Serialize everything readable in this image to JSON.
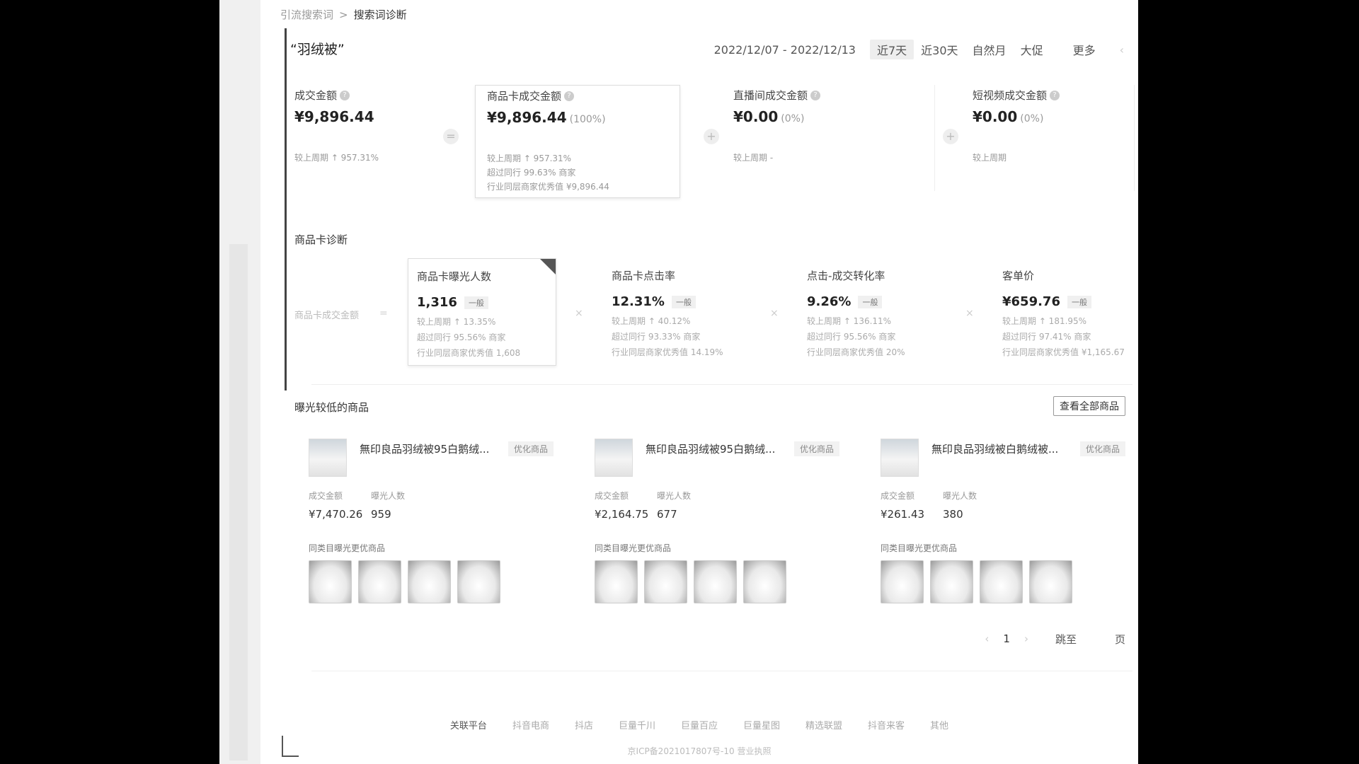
{
  "breadcrumb": {
    "parent": "引流搜索词",
    "sep": ">",
    "current": "搜索词诊断"
  },
  "keyword": "“羽绒被”",
  "date": {
    "range": "2022/12/07 - 2022/12/13",
    "options": [
      "近7天",
      "近30天",
      "自然月",
      "大促",
      "更多"
    ],
    "active": "近7天",
    "chevron": "‹"
  },
  "metrics": [
    {
      "label": "成交金额",
      "value": "¥9,896.44",
      "pct": "",
      "sub1": "较上周期 ↑ 957.31%",
      "sub2": "",
      "sub3": ""
    },
    {
      "label": "商品卡成交金额",
      "value": "¥9,896.44",
      "pct": "(100%)",
      "sub1": "较上周期 ↑ 957.31%",
      "sub2": "超过同行 99.63% 商家",
      "sub3": "行业同层商家优秀值 ¥9,896.44"
    },
    {
      "label": "直播间成交金额",
      "value": "¥0.00",
      "pct": "(0%)",
      "sub1": "较上周期 -",
      "sub2": "",
      "sub3": ""
    },
    {
      "label": "短视频成交金额",
      "value": "¥0.00",
      "pct": "(0%)",
      "sub1": "较上周期",
      "sub2": "",
      "sub3": ""
    }
  ],
  "operators": {
    "eq": "=",
    "plus": "+"
  },
  "diagnosis": {
    "title": "商品卡诊断",
    "left_label": "商品卡成交金额",
    "eq": "=",
    "times": "×",
    "cards": [
      {
        "label": "商品卡曝光人数",
        "value": "1,316",
        "badge": "一般",
        "sub1": "较上周期 ↑ 13.35%",
        "sub2": "超过同行 95.56% 商家",
        "sub3": "行业同层商家优秀值 1,608"
      },
      {
        "label": "商品卡点击率",
        "value": "12.31%",
        "badge": "一般",
        "sub1": "较上周期 ↑ 40.12%",
        "sub2": "超过同行 93.33% 商家",
        "sub3": "行业同层商家优秀值 14.19%"
      },
      {
        "label": "点击-成交转化率",
        "value": "9.26%",
        "badge": "一般",
        "sub1": "较上周期 ↑ 136.11%",
        "sub2": "超过同行 95.56% 商家",
        "sub3": "行业同层商家优秀值 20%"
      },
      {
        "label": "客单价",
        "value": "¥659.76",
        "badge": "一般",
        "sub1": "较上周期 ↑ 181.95%",
        "sub2": "超过同行 97.41% 商家",
        "sub3": "行业同层商家优秀值 ¥1,165.67"
      }
    ]
  },
  "low_exposure": {
    "title": "曝光较低的商品",
    "view_all": "查看全部商品",
    "amount_label": "成交金额",
    "exposure_label": "曝光人数",
    "optimize_label": "优化商品",
    "peer_title": "同类目曝光更优商品",
    "products": [
      {
        "name": "無印良品羽绒被95白鹅绒...",
        "amount": "¥7,470.26",
        "exposure": "959"
      },
      {
        "name": "無印良品羽绒被95白鹅绒...",
        "amount": "¥2,164.75",
        "exposure": "677"
      },
      {
        "name": "無印良品羽绒被白鹅绒被...",
        "amount": "¥261.43",
        "exposure": "380"
      }
    ]
  },
  "pager": {
    "prev": "‹",
    "page": "1",
    "next": "›",
    "jump": "跳至",
    "unit": "页"
  },
  "footer": {
    "links": [
      "关联平台",
      "抖音电商",
      "抖店",
      "巨量千川",
      "巨量百应",
      "巨量星图",
      "精选联盟",
      "抖音来客",
      "其他"
    ],
    "icp": "京ICP备2021017807号-10   营业执照"
  }
}
